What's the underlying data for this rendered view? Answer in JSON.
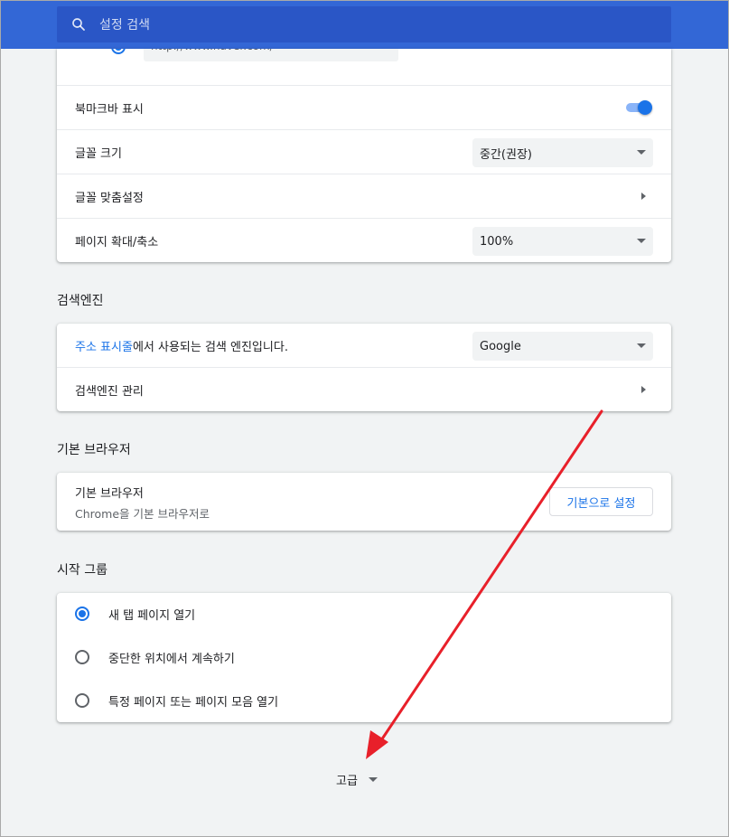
{
  "search": {
    "placeholder": "설정 검색"
  },
  "appearance": {
    "partial_url": "http://www.naver.com/",
    "bookmarks_bar": {
      "label": "북마크바 표시",
      "enabled": true
    },
    "font_size": {
      "label": "글꼴 크기",
      "value": "중간(권장)"
    },
    "custom_fonts": {
      "label": "글꼴 맞춤설정"
    },
    "page_zoom": {
      "label": "페이지 확대/축소",
      "value": "100%"
    }
  },
  "search_engine": {
    "title": "검색엔진",
    "desc_link": "주소 표시줄",
    "desc_rest": "에서 사용되는 검색 엔진입니다.",
    "value": "Google",
    "manage_label": "검색엔진 관리"
  },
  "default_browser": {
    "title": "기본 브라우저",
    "primary": "기본 브라우저",
    "secondary": "Chrome을 기본 브라우저로",
    "button": "기본으로 설정"
  },
  "startup": {
    "title": "시작 그룹",
    "options": [
      {
        "label": "새 탭 페이지 열기",
        "checked": true
      },
      {
        "label": "중단한 위치에서 계속하기",
        "checked": false
      },
      {
        "label": "특정 페이지 또는 페이지 모음 열기",
        "checked": false
      }
    ]
  },
  "advanced": {
    "label": "고급"
  },
  "colors": {
    "header": "#3367d6",
    "search_bg": "#2a56c6",
    "accent": "#1a73e8",
    "annotation_arrow": "#e8202a"
  }
}
